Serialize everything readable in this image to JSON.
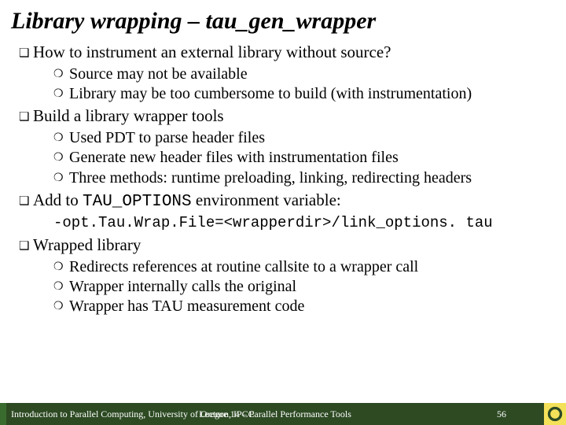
{
  "title": "Library wrapping – tau_gen_wrapper",
  "bullets": [
    {
      "text": "How to instrument an external library without source?",
      "sub": [
        "Source may not be available",
        "Library may be too cumbersome to build (with instrumentation)"
      ]
    },
    {
      "text": "Build a library wrapper tools",
      "sub": [
        "Used PDT to parse header files",
        "Generate new header files with instrumentation files",
        "Three methods: runtime preloading, linking, redirecting headers"
      ]
    },
    {
      "prefix": "Add to ",
      "code": "TAU_OPTIONS",
      "suffix": " environment variable:",
      "codeline": "-opt.Tau.Wrap.File=<wrapperdir>/link_options. tau"
    },
    {
      "text": "Wrapped library",
      "sub": [
        "Redirects references at routine callsite to a wrapper call",
        "Wrapper internally calls the original",
        "Wrapper has TAU measurement code"
      ]
    }
  ],
  "footer": {
    "left": "Introduction to Parallel Computing, University of Oregon, IPCC",
    "center": "Lecture 14 – Parallel Performance Tools",
    "page": "56"
  }
}
